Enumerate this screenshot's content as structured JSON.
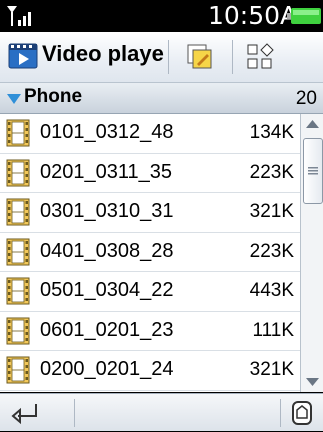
{
  "status_bar": {
    "signal_icon": "signal-strength-icon",
    "clock": "10:50A",
    "battery_icon": "battery-icon"
  },
  "toolbar": {
    "app_icon": "video-player-icon",
    "title": "Video playe",
    "button_1_icon": "note-edit-icon",
    "button_2_icon": "grid-menu-icon"
  },
  "section": {
    "label": "Phone",
    "count": "20",
    "arrow_icon": "expand-arrow-icon"
  },
  "files": [
    {
      "name": "0101_0312_48",
      "size": "134K"
    },
    {
      "name": "0201_0311_35",
      "size": "223K"
    },
    {
      "name": "0301_0310_31",
      "size": "321K"
    },
    {
      "name": "0401_0308_28",
      "size": "223K"
    },
    {
      "name": "0501_0304_22",
      "size": "443K"
    },
    {
      "name": "0601_0201_23",
      "size": "111K"
    },
    {
      "name": "0200_0201_24",
      "size": "321K"
    }
  ],
  "scrollbar": {
    "position": 0.0,
    "visible_fraction": 0.35
  },
  "bottom_bar": {
    "back_icon": "back-arrow-icon",
    "home_icon": "home-icon"
  },
  "colors": {
    "status_bar_bg": "#000000",
    "battery_fill": "#3fd13f",
    "selection_arrow": "#2f8fd8",
    "filmstrip": "#d8a020"
  }
}
